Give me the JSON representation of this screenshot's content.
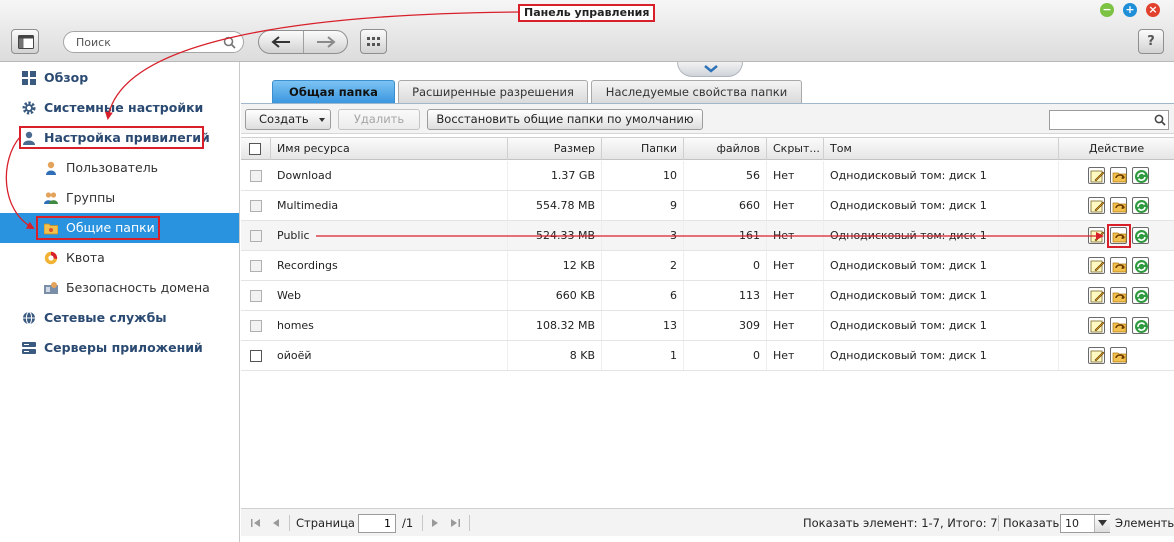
{
  "window": {
    "title": "Панель управления"
  },
  "topbar": {
    "search_placeholder": "Поиск",
    "help_label": "?"
  },
  "sidebar": {
    "items": [
      {
        "label": "Обзор",
        "level": "top",
        "icon": "overview-icon"
      },
      {
        "label": "Системные настройки",
        "level": "top",
        "icon": "gear-icon"
      },
      {
        "label": "Настройка привилегий",
        "level": "top",
        "icon": "user-icon"
      },
      {
        "label": "Пользователь",
        "level": "sub",
        "icon": "user-icon"
      },
      {
        "label": "Группы",
        "level": "sub",
        "icon": "group-icon"
      },
      {
        "label": "Общие папки",
        "level": "sub",
        "icon": "folder-icon",
        "selected": true
      },
      {
        "label": "Квота",
        "level": "sub",
        "icon": "quota-icon"
      },
      {
        "label": "Безопасность домена",
        "level": "sub",
        "icon": "domain-icon"
      },
      {
        "label": "Сетевые службы",
        "level": "top",
        "icon": "globe-icon"
      },
      {
        "label": "Серверы приложений",
        "level": "top",
        "icon": "server-icon"
      }
    ]
  },
  "tabs": [
    {
      "label": "Общая папка",
      "active": true
    },
    {
      "label": "Расширенные разрешения",
      "active": false
    },
    {
      "label": "Наследуемые свойства папки",
      "active": false
    }
  ],
  "toolbar": {
    "create_label": "Создать",
    "delete_label": "Удалить",
    "restore_label": "Восстановить общие папки по умолчанию"
  },
  "table": {
    "columns": {
      "name": "Имя ресурса",
      "size": "Размер",
      "folders": "Папки",
      "files": "файлов",
      "hidden": "Скрыт...",
      "volume": "Том",
      "action": "Действие"
    },
    "rows": [
      {
        "name": "Download",
        "size": "1.37 GB",
        "folders": "10",
        "files": "56",
        "hidden": "Нет",
        "volume": "Однодисковый том: диск 1"
      },
      {
        "name": "Multimedia",
        "size": "554.78 MB",
        "folders": "9",
        "files": "660",
        "hidden": "Нет",
        "volume": "Однодисковый том: диск 1"
      },
      {
        "name": "Public",
        "size": "524.33 MB",
        "folders": "3",
        "files": "161",
        "hidden": "Нет",
        "volume": "Однодисковый том: диск 1"
      },
      {
        "name": "Recordings",
        "size": "12 KB",
        "folders": "2",
        "files": "0",
        "hidden": "Нет",
        "volume": "Однодисковый том: диск 1"
      },
      {
        "name": "Web",
        "size": "660 KB",
        "folders": "6",
        "files": "113",
        "hidden": "Нет",
        "volume": "Однодисковый том: диск 1"
      },
      {
        "name": "homes",
        "size": "108.32 MB",
        "folders": "13",
        "files": "309",
        "hidden": "Нет",
        "volume": "Однодисковый том: диск 1"
      },
      {
        "name": "ойоёй",
        "size": "8 KB",
        "folders": "1",
        "files": "0",
        "hidden": "Нет",
        "volume": "Однодисковый том: диск 1"
      }
    ]
  },
  "pager": {
    "page_label": "Страница",
    "page_value": "1",
    "page_total": "/1",
    "summary": "Показать элемент: 1-7, Итого: 7",
    "show_label": "Показать",
    "per_page": "10",
    "items_label": "Элементы"
  },
  "colors": {
    "accent": "#2a93e0",
    "annotation": "#d8202a"
  }
}
